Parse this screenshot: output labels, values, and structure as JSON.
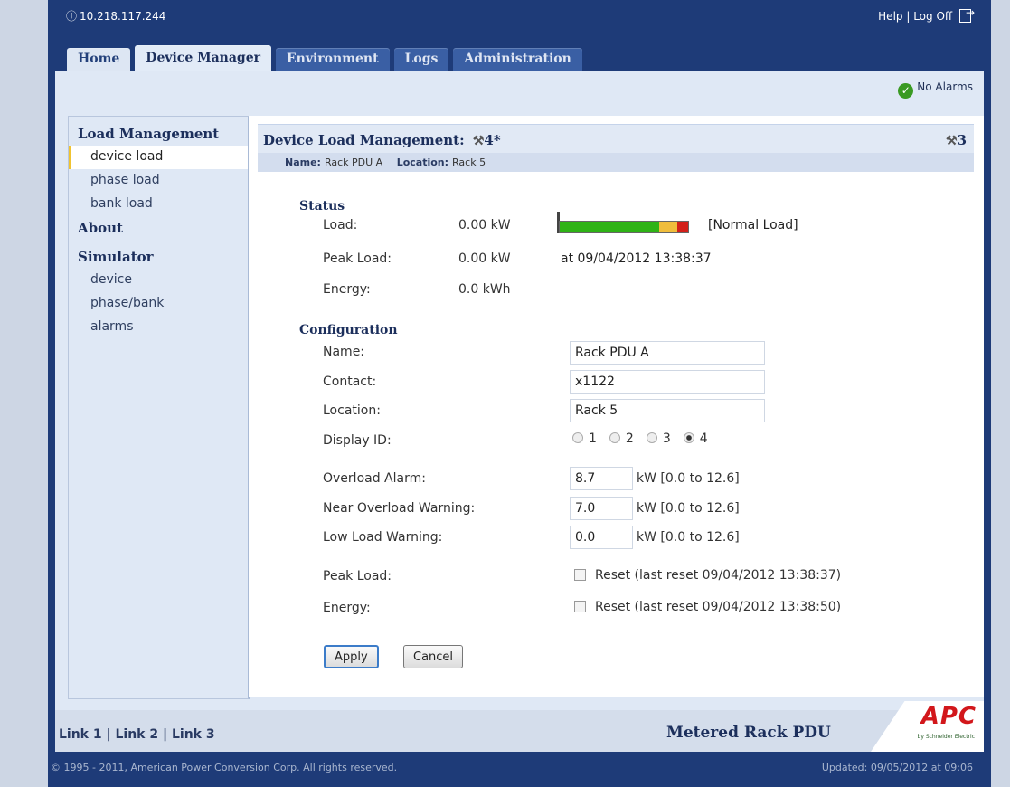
{
  "topbar": {
    "ip": "10.218.117.244",
    "help": "Help",
    "log_off": "Log Off"
  },
  "tabs": [
    {
      "label": "Home"
    },
    {
      "label": "Device Manager"
    },
    {
      "label": "Environment"
    },
    {
      "label": "Logs"
    },
    {
      "label": "Administration"
    }
  ],
  "alarms": {
    "text": "No Alarms"
  },
  "sidebar": {
    "load_management": "Load Management",
    "device_load": "device load",
    "phase_load": "phase load",
    "bank_load": "bank load",
    "about": "About",
    "simulator": "Simulator",
    "device": "device",
    "phase_bank": "phase/bank",
    "alarms": "alarms"
  },
  "main": {
    "title": "Device Load Management:",
    "title_id": "4*",
    "right_id": "3",
    "name_label": "Name:",
    "name_value": "Rack PDU A",
    "location_label": "Location:",
    "location_value": "Rack 5"
  },
  "status": {
    "title": "Status",
    "load_label": "Load:",
    "load_value": "0.00 kW",
    "load_state": "[Normal Load]",
    "load_fraction": 0.0,
    "peak_label": "Peak Load:",
    "peak_value": "0.00 kW",
    "peak_at": "at 09/04/2012 13:38:37",
    "energy_label": "Energy:",
    "energy_value": "0.0 kWh"
  },
  "config": {
    "title": "Configuration",
    "name_label": "Name:",
    "name_value": "Rack PDU A",
    "contact_label": "Contact:",
    "contact_value": "x1122",
    "location_label": "Location:",
    "location_value": "Rack 5",
    "display_id_label": "Display ID:",
    "display_ids": [
      "1",
      "2",
      "3",
      "4"
    ],
    "display_id_selected": "4",
    "overload_label": "Overload Alarm:",
    "overload_value": "8.7",
    "near_label": "Near Overload Warning:",
    "near_value": "7.0",
    "low_label": "Low Load Warning:",
    "low_value": "0.0",
    "range": "kW [0.0 to 12.6]",
    "peak_label": "Peak Load:",
    "peak_reset": "Reset (last reset 09/04/2012 13:38:37)",
    "energy_label": "Energy:",
    "energy_reset": "Reset (last reset 09/04/2012 13:38:50)",
    "apply": "Apply",
    "cancel": "Cancel"
  },
  "footer": {
    "link1": "Link 1",
    "link2": "Link 2",
    "link3": "Link 3",
    "separator": " | ",
    "product": "Metered Rack PDU",
    "logo": "APC",
    "logo_sub": "by Schneider Electric",
    "copyright": "© 1995 - 2011, American Power Conversion Corp. All rights reserved.",
    "updated": "Updated: 09/05/2012 at 09:06"
  },
  "colors": {
    "banner": "#1e3b78",
    "accent": "#f0c330",
    "load_green": "#2fb316",
    "load_yellow": "#f0bd3c",
    "load_red": "#d3201a",
    "alarm_ok": "#3a9a23"
  }
}
